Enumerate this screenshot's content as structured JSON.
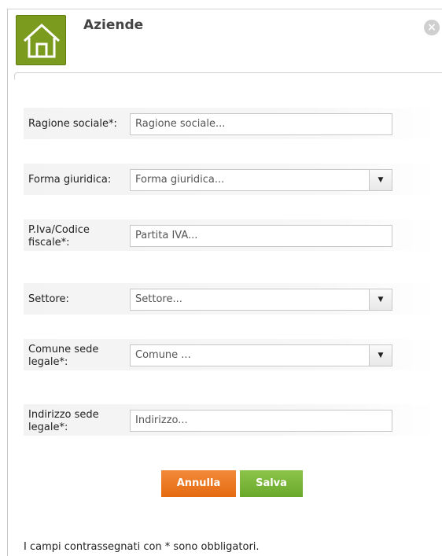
{
  "header": {
    "title": "Aziende",
    "close_label": "×",
    "logo_icon": "house-icon"
  },
  "form": {
    "fields": [
      {
        "label": "Ragione sociale*:",
        "placeholder": "Ragione sociale...",
        "type": "text"
      },
      {
        "label": "Forma giuridica:",
        "placeholder": "Forma giuridica...",
        "type": "select"
      },
      {
        "label": "P.Iva/Codice fiscale*:",
        "placeholder": "Partita IVA...",
        "type": "text"
      },
      {
        "label": "Settore:",
        "placeholder": "Settore...",
        "type": "select"
      },
      {
        "label": "Comune sede legale*:",
        "placeholder": "Comune ...",
        "type": "select"
      },
      {
        "label": "Indirizzo sede legale*:",
        "placeholder": "Indirizzo...",
        "type": "text"
      }
    ]
  },
  "buttons": {
    "cancel_label": "Annulla",
    "save_label": "Salva"
  },
  "footer": {
    "note": "I campi contrassegnati con * sono obbligatori."
  },
  "colors": {
    "logo": "#7a9b1e",
    "cancel": "#e46a10",
    "save": "#6aa82a"
  }
}
